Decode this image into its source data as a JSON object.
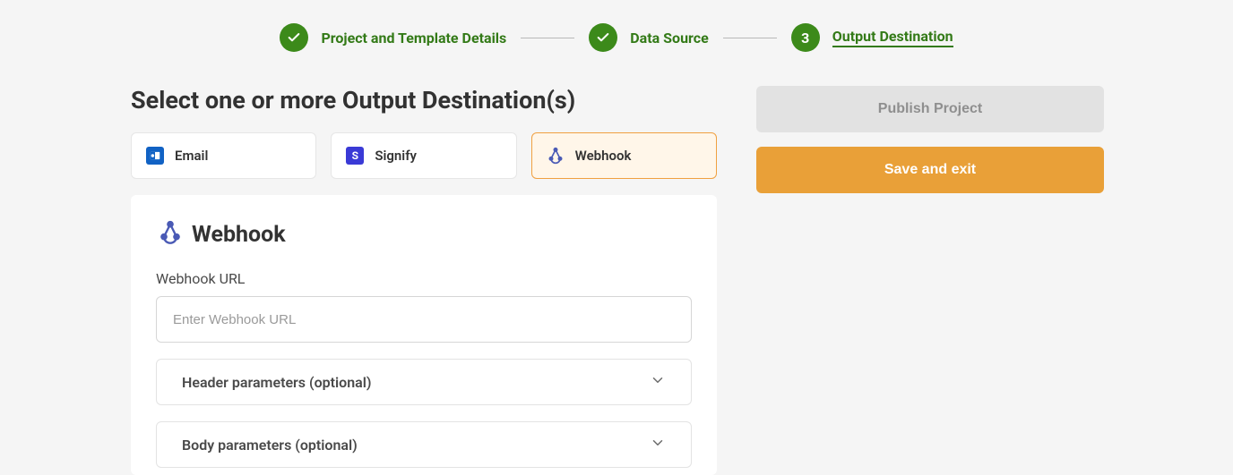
{
  "stepper": {
    "steps": [
      {
        "label": "Project and Template Details",
        "state": "done"
      },
      {
        "label": "Data Source",
        "state": "done"
      },
      {
        "label": "Output Destination",
        "state": "current",
        "number": "3"
      }
    ]
  },
  "page_title": "Select one or more Output Destination(s)",
  "destinations": {
    "email": {
      "label": "Email",
      "icon": "outlook",
      "selected": false
    },
    "signify": {
      "label": "Signify",
      "icon": "signify",
      "glyph": "S",
      "selected": false
    },
    "webhook": {
      "label": "Webhook",
      "icon": "webhook",
      "selected": true
    }
  },
  "webhook_panel": {
    "title": "Webhook",
    "url_label": "Webhook URL",
    "url_value": "",
    "url_placeholder": "Enter Webhook URL",
    "sections": {
      "header_params": {
        "label": "Header parameters (optional)"
      },
      "body_params": {
        "label": "Body parameters (optional)"
      }
    }
  },
  "actions": {
    "publish": "Publish Project",
    "save_exit": "Save and exit"
  },
  "colors": {
    "brand_green": "#3c8a1a",
    "brand_orange": "#e9a038",
    "select_border": "#f0a040",
    "select_bg": "#fff6e9"
  }
}
